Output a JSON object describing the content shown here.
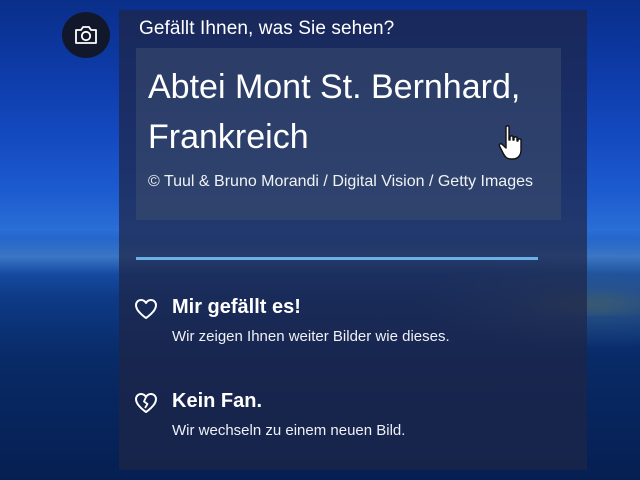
{
  "spotlight": {
    "question": "Gefällt Ihnen, was Sie sehen?",
    "camera_icon": "camera-icon",
    "title_line1": "Abtei Mont St. Bernhard,",
    "title_line2": "Frankreich",
    "credit": "© Tuul & Bruno Morandi / Digital Vision / Getty Images",
    "options": [
      {
        "icon": "heart-icon",
        "title": "Mir gefällt es!",
        "description": "Wir zeigen Ihnen weiter Bilder wie dieses."
      },
      {
        "icon": "broken-heart-icon",
        "title": "Kein Fan.",
        "description": "Wir wechseln zu einem neuen Bild."
      }
    ],
    "accent_color": "#6cb0e8"
  }
}
